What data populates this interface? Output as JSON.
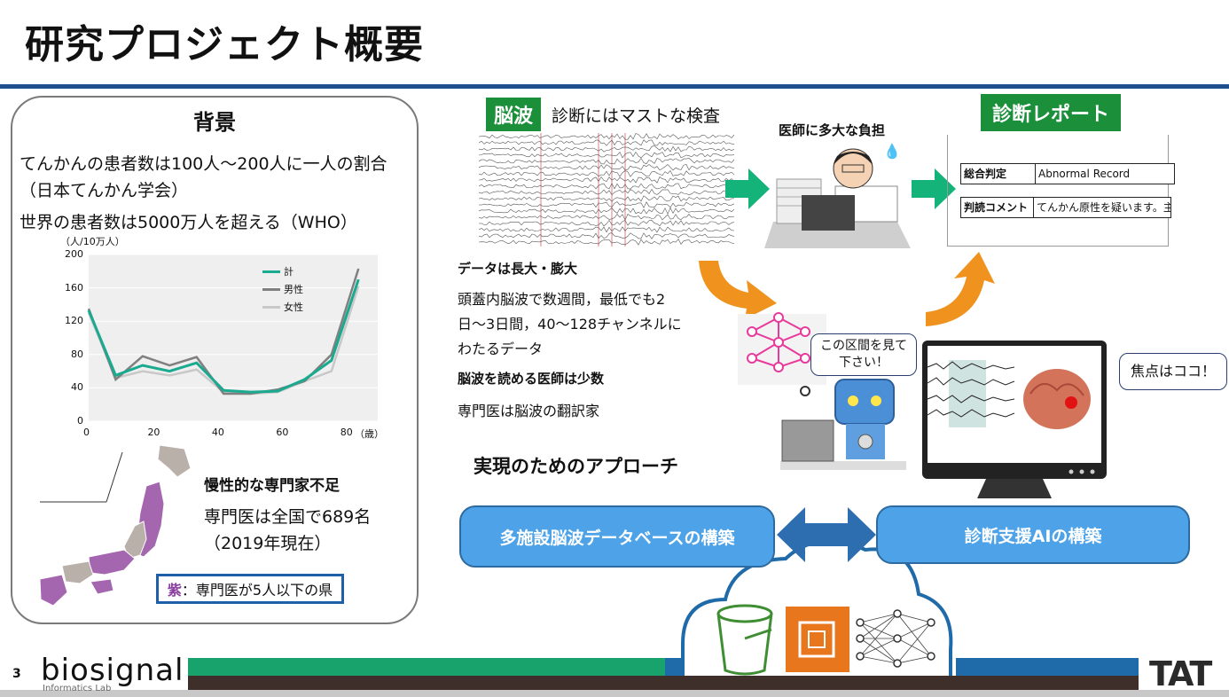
{
  "title": "研究プロジェクト概要",
  "background": {
    "heading": "背景",
    "line1": "てんかんの患者数は100人～200人に一人の割合",
    "line2": "（日本てんかん学会）",
    "line3": "世界の患者数は5000万人を超える（WHO）"
  },
  "chart_data": {
    "type": "line",
    "title": "",
    "ylabel": "（人/10万人）",
    "xlabel": "（歳）",
    "ylim": [
      0,
      200
    ],
    "yticks": [
      "0",
      "40",
      "80",
      "120",
      "160",
      "200"
    ],
    "xticks": [
      "0",
      "20",
      "40",
      "60",
      "80"
    ],
    "legend_position": "top-right",
    "x": [
      0,
      10,
      20,
      30,
      40,
      50,
      60,
      70,
      80,
      90
    ],
    "series": [
      {
        "name": "計",
        "color": "#1aaa8f",
        "values": [
          133,
          55,
          67,
          60,
          70,
          37,
          35,
          36,
          50,
          73,
          170
        ]
      },
      {
        "name": "男性",
        "color": "#808080",
        "values": [
          135,
          50,
          78,
          67,
          77,
          33,
          33,
          38,
          48,
          80,
          183
        ]
      },
      {
        "name": "女性",
        "color": "#c8c8c8",
        "values": [
          130,
          52,
          60,
          55,
          62,
          35,
          33,
          35,
          48,
          60,
          162
        ]
      }
    ]
  },
  "shortage": {
    "heading": "慢性的な専門家不足",
    "count": "専門医は全国で689名",
    "year": "（2019年現在）",
    "legend_key": "紫",
    "legend_text": "：専門医が5人以下の県"
  },
  "eeg": {
    "tag": "脳波",
    "caption": "診断にはマストな検査",
    "doctor_burden": "医師に多大な負担",
    "b1_head": "データは長大・膨大",
    "b1_l1": "頭蓋内脳波で数週間，最低でも2",
    "b1_l2": "日～3日間，40～128チャンネルに",
    "b1_l3": "わたるデータ",
    "b2_head": "脳波を読める医師は少数",
    "b2_text": "専門医は脳波の翻訳家"
  },
  "report": {
    "tag": "診断レポート",
    "row1_key": "総合判定",
    "row1_val": "Abnormal Record",
    "row2_key": "判読コメント",
    "row2_val": "てんかん原性を疑います。主"
  },
  "bubbles": {
    "robot": "この区間を見て下さい！",
    "focus": "焦点はココ！"
  },
  "approach": {
    "heading": "実現のためのアプローチ",
    "left": "多施設脳波データベースの構築",
    "right": "診断支援AIの構築"
  },
  "footer": {
    "page": "3",
    "logo": "biosignal",
    "logo_sub": "Informatics Lab",
    "org": "TAT"
  },
  "colors": {
    "title_rule": "#1f4e8c",
    "green_tag": "#1b8f3a",
    "arrow_green": "#14b37a",
    "arrow_orange": "#f0921e",
    "pill_blue": "#4ea3e8",
    "footer_green": "#17a36b",
    "footer_blue": "#1f6aa8",
    "footer_dark": "#3e2f2b",
    "prefecture_purple": "#a566b0"
  }
}
